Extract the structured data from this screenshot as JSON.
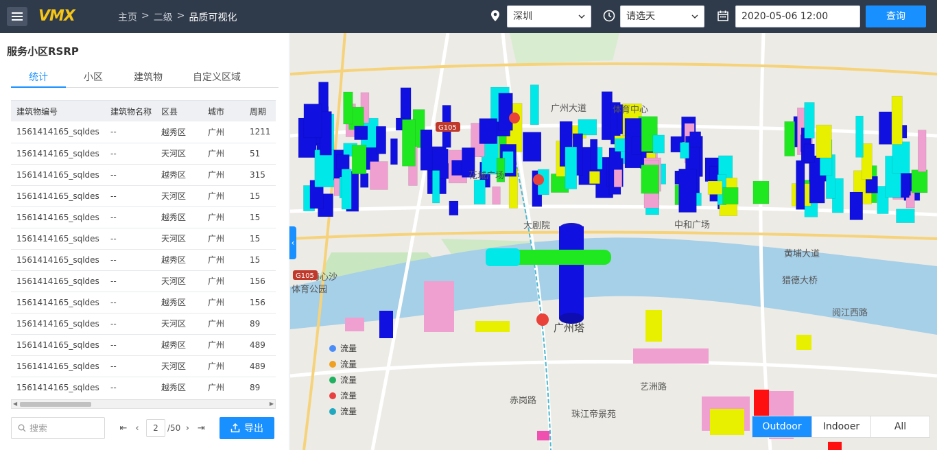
{
  "app": {
    "logo_text": "VMX"
  },
  "breadcrumb": [
    "主页",
    "二级",
    "品质可视化"
  ],
  "filters": {
    "city": "深圳",
    "period": "请选天",
    "datetime": "2020-05-06 12:00",
    "query_label": "查询"
  },
  "panel": {
    "title": "服务小区RSRP",
    "tabs": [
      "统计",
      "小区",
      "建筑物",
      "自定义区域"
    ],
    "active_tab": 0,
    "columns": [
      "建筑物编号",
      "建筑物名称",
      "区县",
      "城市",
      "周期"
    ],
    "rows": [
      [
        "1561414165_sqldes",
        "--",
        "越秀区",
        "广州",
        "1211"
      ],
      [
        "1561414165_sqldes",
        "--",
        "天河区",
        "广州",
        "51"
      ],
      [
        "1561414165_sqldes",
        "--",
        "越秀区",
        "广州",
        "315"
      ],
      [
        "1561414165_sqldes",
        "--",
        "天河区",
        "广州",
        "15"
      ],
      [
        "1561414165_sqldes",
        "--",
        "越秀区",
        "广州",
        "15"
      ],
      [
        "1561414165_sqldes",
        "--",
        "天河区",
        "广州",
        "15"
      ],
      [
        "1561414165_sqldes",
        "--",
        "越秀区",
        "广州",
        "15"
      ],
      [
        "1561414165_sqldes",
        "--",
        "天河区",
        "广州",
        "156"
      ],
      [
        "1561414165_sqldes",
        "--",
        "越秀区",
        "广州",
        "156"
      ],
      [
        "1561414165_sqldes",
        "--",
        "天河区",
        "广州",
        "89"
      ],
      [
        "1561414165_sqldes",
        "--",
        "越秀区",
        "广州",
        "489"
      ],
      [
        "1561414165_sqldes",
        "--",
        "天河区",
        "广州",
        "489"
      ],
      [
        "1561414165_sqldes",
        "--",
        "越秀区",
        "广州",
        "89"
      ]
    ],
    "search_placeholder": "搜索",
    "page_current": "2",
    "page_total": "/50",
    "export_label": "导出"
  },
  "map": {
    "labels": [
      "广州塔",
      "体育中心",
      "大剧院",
      "中和广场",
      "猎德大桥",
      "海心沙",
      "花城广场",
      "艺洲路",
      "赤岗路",
      "珠江帝景苑",
      "阅江西路",
      "体育公园",
      "广州大道",
      "黄埔大道",
      "G105"
    ],
    "legend": [
      {
        "label": "流量",
        "color": "#4b8df8"
      },
      {
        "label": "流量",
        "color": "#f0a020"
      },
      {
        "label": "流量",
        "color": "#20b060"
      },
      {
        "label": "流量",
        "color": "#e84040"
      },
      {
        "label": "流量",
        "color": "#20a8c0"
      }
    ],
    "views": [
      "Outdoor",
      "Indooer",
      "All"
    ],
    "active_view": 0
  },
  "colors": {
    "accent": "#1890ff",
    "header_bg": "#2f3a4a",
    "river": "#a6cfe8",
    "building_blue": "#1010e0",
    "building_cyan": "#00e8e8",
    "building_yellow": "#e8f000",
    "building_green": "#20e820",
    "building_pink": "#f0a0d0",
    "building_red": "#ff1010"
  }
}
